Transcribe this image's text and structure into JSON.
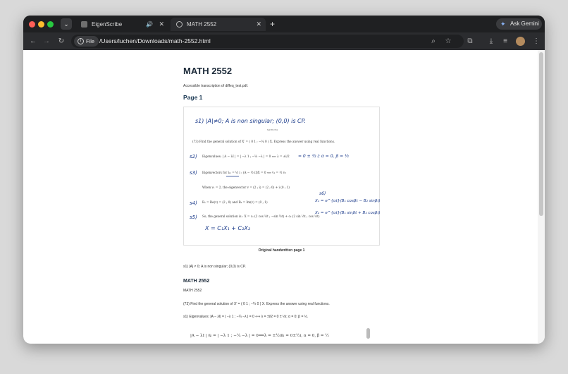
{
  "browser": {
    "tabs": [
      {
        "title": "EigenScribe",
        "audio_icon": "speaker-icon",
        "close": "✕"
      },
      {
        "title": "MATH 2552",
        "close": "✕"
      }
    ],
    "new_tab": "+",
    "gemini_label": "Ask Gemini",
    "chip_label": "File",
    "url": "/Users/luchen/Downloads/math-2552.html",
    "colors": {
      "close": "#ff5f57",
      "minimize": "#febc2e",
      "maximize": "#28c840",
      "accent": "#8ab4f8"
    }
  },
  "page": {
    "title": "MATH 2552",
    "subtitle": "Accessible transcription of diffeq_test.pdf.",
    "section_heading": "Page 1",
    "handwritten": {
      "line1": "s1) |A|≠0; A is non singular; (0,0) is CP.",
      "header_small": "MATH 2552",
      "problem": "(73) Find the general solution of X′ = ( 0 1 ; −¼ 0 ) X. Express the answer using real functions.",
      "s2_label": "s2)",
      "s2_text": "Eigenvalues: | A − λI | = | −λ 1 ; −¼ −λ | = 0 ⟺ λ = ±i/2",
      "s2_hand": "= 0 ± ½ i; α = 0, β = ½",
      "s3_label": "s3)",
      "s3_text": "Eigenvectors for λ₁ = ½ i : (A − ½ iI)X = 0 ⟺ v₁ = ½ v₂",
      "when_text": "When v₁ = 2, the eigenvector v = (2 ; i) = (2 ; 0) + i (0 ; 1)",
      "s4_label": "s4)",
      "s4_text": "B₁ = Re(v) = (2 ; 0) and B₂ = Im(v) = (0 ; 1)",
      "s5_label": "s5)",
      "s5_text": "So, the general solution is : X = c₁ (2 cos ½t ; −sin ½t) + c₂ (2 sin ½t ; cos ½t)",
      "s6_label": "s6)",
      "x1": "X₁ = e^{αt}(B₁ cosβt − B₂ sinβt)",
      "x2": "X₂ = e^{αt}(B₁ sinβt + B₂ cosβt)",
      "final": "X = C₁X₁ + C₂X₂"
    },
    "caption": "Original handwritten page 1",
    "transcript_s1": "s1) |A| ≠ 0; A is non singular; (0,0) is CP.",
    "heading2": "MATH 2552",
    "small2": "MATH 2552",
    "problem_text": "(73) Find the general solution of X′ = ( 0 1 ; −¼ 0 ) X. Express the answer using real functions.",
    "eigen_text": "s1) Eigenvalues: |A − λI| = | −λ 1 ; −¼ −λ | = 0 ⟺ λ = ±i/2 = 0 ± ½i; α = 0; β = ½.",
    "formula": "|A − λI | & = |  −λ   1 ; −¼   −λ  | = 0⟺λ = ±½i& = 0±½i,      α = 0,      β = ½"
  }
}
